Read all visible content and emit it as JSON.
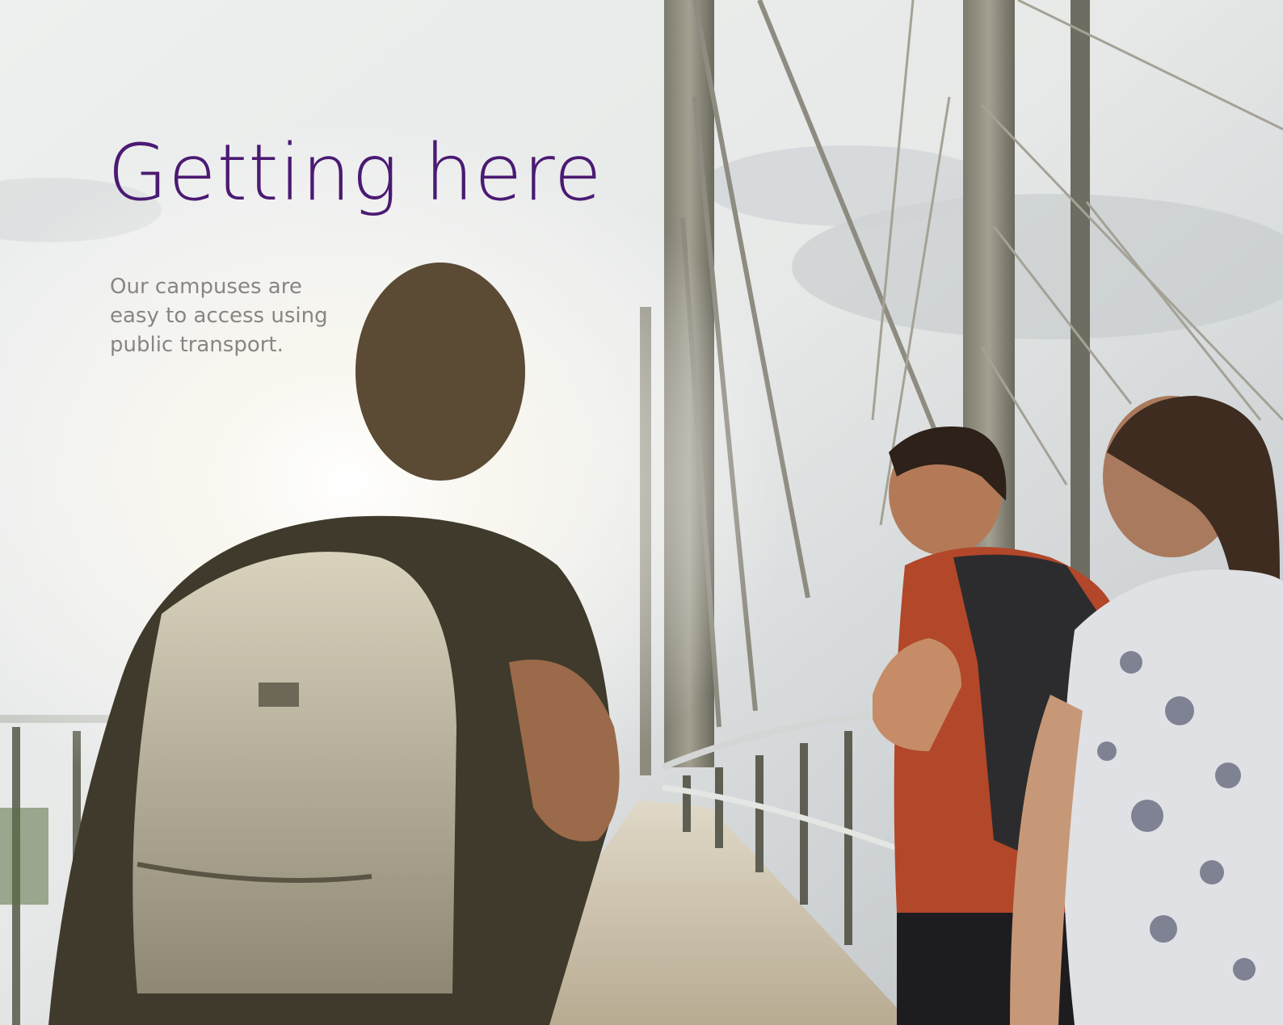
{
  "page": {
    "title": "Getting here",
    "intro": "Our campuses are easy to access using public transport."
  },
  "photo": {
    "subject": "students walking across a cable-stayed pedestrian bridge",
    "icon": "photo"
  },
  "colors": {
    "title": "#4b1a73",
    "intro": "#8a8584"
  }
}
